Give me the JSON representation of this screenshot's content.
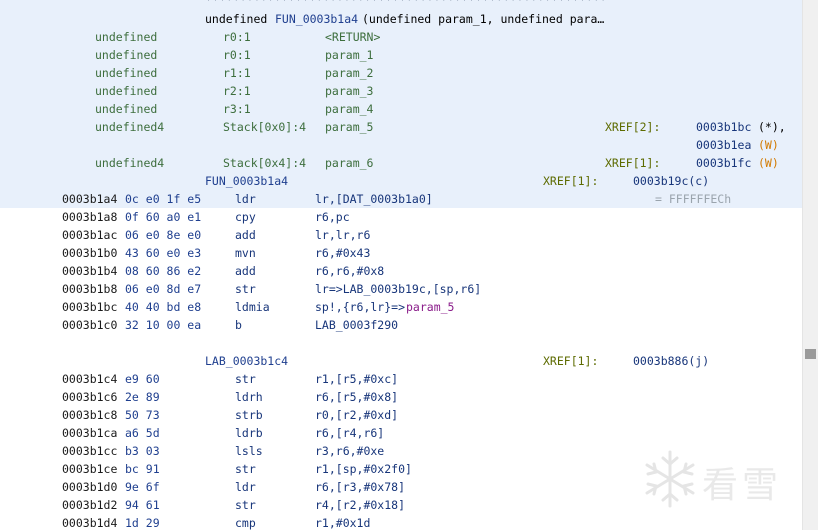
{
  "function": {
    "stars_line": "**********************************************************",
    "signature": {
      "ret": "undefined",
      "name": "FUN_0003b1a4",
      "args": "(undefined param_1, undefined para…"
    },
    "params": [
      {
        "type": "undefined",
        "storage": "r0:1",
        "name": "<RETURN>",
        "xref_label": "",
        "xref_val": "",
        "xref_suffix": "",
        "suffix_color": ""
      },
      {
        "type": "undefined",
        "storage": "r0:1",
        "name": "param_1",
        "xref_label": "",
        "xref_val": "",
        "xref_suffix": "",
        "suffix_color": ""
      },
      {
        "type": "undefined",
        "storage": "r1:1",
        "name": "param_2",
        "xref_label": "",
        "xref_val": "",
        "xref_suffix": "",
        "suffix_color": ""
      },
      {
        "type": "undefined",
        "storage": "r2:1",
        "name": "param_3",
        "xref_label": "",
        "xref_val": "",
        "xref_suffix": "",
        "suffix_color": ""
      },
      {
        "type": "undefined",
        "storage": "r3:1",
        "name": "param_4",
        "xref_label": "",
        "xref_val": "",
        "xref_suffix": "",
        "suffix_color": ""
      },
      {
        "type": "undefined4",
        "storage": "Stack[0x0]:4",
        "name": "param_5",
        "xref_label": "XREF[2]:",
        "xref_val": "0003b1bc",
        "xref_suffix": "(*),",
        "suffix_color": "#000000"
      },
      {
        "type": "",
        "storage": "",
        "name": "",
        "xref_label": "",
        "xref_val": "0003b1ea",
        "xref_suffix": "(W)",
        "suffix_color": "#d27a00"
      },
      {
        "type": "undefined4",
        "storage": "Stack[0x4]:4",
        "name": "param_6",
        "xref_label": "XREF[1]:",
        "xref_val": "0003b1fc",
        "xref_suffix": "(W)",
        "suffix_color": "#d27a00"
      }
    ],
    "label": {
      "name": "FUN_0003b1a4",
      "xref_label": "XREF[1]:",
      "xref_val": "0003b19c(c)"
    }
  },
  "instructions": [
    {
      "addr": "0003b1a4",
      "bytes": "0c e0 1f e5",
      "mnemonic": "ldr",
      "operands": "lr,[DAT_0003b1a0]",
      "operand_extra": "",
      "comment": "= FFFFFFECh"
    },
    {
      "addr": "0003b1a8",
      "bytes": "0f 60 a0 e1",
      "mnemonic": "cpy",
      "operands": "r6,pc",
      "operand_extra": "",
      "comment": ""
    },
    {
      "addr": "0003b1ac",
      "bytes": "06 e0 8e e0",
      "mnemonic": "add",
      "operands": "lr,lr,r6",
      "operand_extra": "",
      "comment": ""
    },
    {
      "addr": "0003b1b0",
      "bytes": "43 60 e0 e3",
      "mnemonic": "mvn",
      "operands": "r6,#0x43",
      "operand_extra": "",
      "comment": ""
    },
    {
      "addr": "0003b1b4",
      "bytes": "08 60 86 e2",
      "mnemonic": "add",
      "operands": "r6,r6,#0x8",
      "operand_extra": "",
      "comment": ""
    },
    {
      "addr": "0003b1b8",
      "bytes": "06 e0 8d e7",
      "mnemonic": "str",
      "operands": "lr=>LAB_0003b19c,[sp,r6]",
      "operand_extra": "",
      "comment": ""
    },
    {
      "addr": "0003b1bc",
      "bytes": "40 40 bd e8",
      "mnemonic": "ldmia",
      "operands": "sp!,{r6,lr}=>",
      "operand_extra": "param_5",
      "comment": ""
    },
    {
      "addr": "0003b1c0",
      "bytes": "32 10 00 ea",
      "mnemonic": "b",
      "operands": "LAB_0003f290",
      "operand_extra": "",
      "comment": ""
    }
  ],
  "label2": {
    "name": "LAB_0003b1c4",
    "xref_label": "XREF[1]:",
    "xref_val": "0003b886(j)"
  },
  "instructions2": [
    {
      "addr": "0003b1c4",
      "bytes": "e9 60",
      "mnemonic": "str",
      "operands": "r1,[r5,#0xc]"
    },
    {
      "addr": "0003b1c6",
      "bytes": "2e 89",
      "mnemonic": "ldrh",
      "operands": "r6,[r5,#0x8]"
    },
    {
      "addr": "0003b1c8",
      "bytes": "50 73",
      "mnemonic": "strb",
      "operands": "r0,[r2,#0xd]"
    },
    {
      "addr": "0003b1ca",
      "bytes": "a6 5d",
      "mnemonic": "ldrb",
      "operands": "r6,[r4,r6]"
    },
    {
      "addr": "0003b1cc",
      "bytes": "b3 03",
      "mnemonic": "lsls",
      "operands": "r3,r6,#0xe"
    },
    {
      "addr": "0003b1ce",
      "bytes": "bc 91",
      "mnemonic": "str",
      "operands": "r1,[sp,#0x2f0]"
    },
    {
      "addr": "0003b1d0",
      "bytes": "9e 6f",
      "mnemonic": "ldr",
      "operands": "r6,[r3,#0x78]"
    },
    {
      "addr": "0003b1d2",
      "bytes": "94 61",
      "mnemonic": "str",
      "operands": "r4,[r2,#0x18]"
    },
    {
      "addr": "0003b1d4",
      "bytes": "1d 29",
      "mnemonic": "cmp",
      "operands": "r1,#0x1d"
    }
  ],
  "watermark": {
    "text": "看雪",
    "icon": "snowflake-icon"
  },
  "colors": {
    "band": "#e8f0fb",
    "navy": "#17357a",
    "green": "#3d6e3d",
    "olive": "#5d6b00",
    "orange": "#d27a00",
    "purple": "#8a1c8a"
  }
}
